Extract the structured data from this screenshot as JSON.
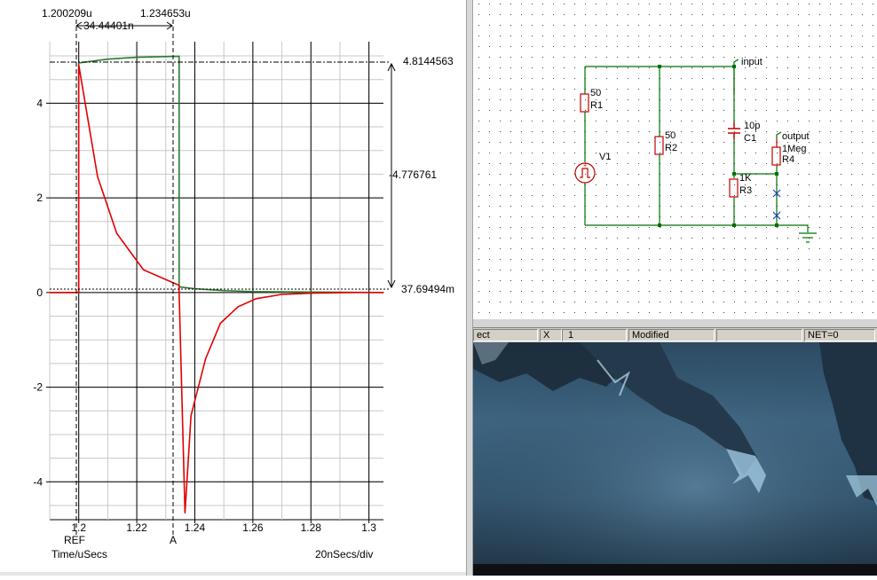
{
  "plot": {
    "cursor_ref_time": "1.200209u",
    "cursor_a_time": "1.234653u",
    "delta_time": "34.44401n",
    "max_value": "4.8144563",
    "delta_value": "-4.776761",
    "min_value": "37.69494m",
    "y_tick_labels": [
      "4",
      "2",
      "0",
      "-2",
      "-4"
    ],
    "x_tick_labels": [
      "1.2",
      "1.22",
      "1.24",
      "1.26",
      "1.28",
      "1.3"
    ],
    "cursor_ref_label": "REF",
    "cursor_a_label": "A",
    "x_axis_label": "Time/uSecs",
    "time_per_div": "20nSecs/div",
    "colors": {
      "trace_input": "#2a7a2a",
      "trace_output": "#e00000",
      "grid": "#000000"
    }
  },
  "chart_data": {
    "type": "line",
    "xlabel": "Time/uSecs",
    "xlim": [
      1.19,
      1.305
    ],
    "ylim": [
      -4.8,
      5.3
    ],
    "x_ticks": [
      1.2,
      1.22,
      1.24,
      1.26,
      1.28,
      1.3
    ],
    "y_ticks": [
      4,
      2,
      0,
      -2,
      -4
    ],
    "grid": true,
    "series": [
      {
        "color": "#2a7a2a",
        "x": [
          1.19,
          1.2,
          1.2,
          1.21,
          1.22,
          1.2346,
          1.2346,
          1.24,
          1.25,
          1.26,
          1.28,
          1.305
        ],
        "y": [
          0.0,
          0.0,
          4.85,
          4.93,
          4.97,
          4.99,
          0.12,
          0.08,
          0.04,
          0.02,
          0.01,
          0.0
        ]
      },
      {
        "color": "#e00000",
        "x": [
          1.19,
          1.2,
          1.2,
          1.2065,
          1.2131,
          1.2223,
          1.2346,
          1.2346,
          1.2366,
          1.2387,
          1.2437,
          1.2488,
          1.2549,
          1.2611,
          1.2699,
          1.2813,
          1.2955,
          1.305
        ],
        "y": [
          0.0,
          0.0,
          4.81,
          2.45,
          1.25,
          0.48,
          0.15,
          0.0,
          -4.66,
          -2.6,
          -1.4,
          -0.65,
          -0.3,
          -0.13,
          -0.04,
          -0.01,
          0.0,
          0.0
        ]
      }
    ]
  },
  "schematic": {
    "components": [
      {
        "value": "50",
        "ref": "R1"
      },
      {
        "value": "50",
        "ref": "R2"
      },
      {
        "value": "10p",
        "ref": "C1"
      },
      {
        "value": "1K",
        "ref": "R3"
      },
      {
        "value": "1Meg",
        "ref": "R4"
      },
      {
        "ref": "V1"
      }
    ],
    "nets": [
      "input",
      "output"
    ],
    "colors": {
      "wire": "#007000",
      "component": "#c00000",
      "junction": "#007000",
      "marker": "#2040c0"
    }
  },
  "status_bar": {
    "mode": "ect",
    "x_label": "X",
    "x_value": "1",
    "modified": "Modified",
    "empty": "",
    "net": "NET=0"
  }
}
